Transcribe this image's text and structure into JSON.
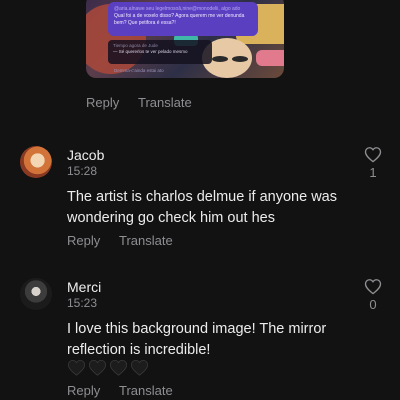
{
  "attachment": {
    "chat_top": "@aria.alnawe seu legelmosoâ,nine@monodelii, algo ado",
    "chat_line_1": "Qual foi a de voxelo disso? Agora querem me ver denunda",
    "chat_line_2": "bem? Que petifora é essa?!",
    "reply_header": "Tiempo agora de Jude",
    "reply_text": "— Sé quererlos te ver pelado mesmo",
    "footer": "Demma-c'ainda estai ato"
  },
  "post_actions": {
    "reply": "Reply",
    "translate": "Translate"
  },
  "comments": [
    {
      "author": "Jacob",
      "time": "15:28",
      "text": "The artist is charlos delmue if anyone was wondering go check him out hes",
      "likes": "1",
      "reply": "Reply",
      "translate": "Translate",
      "avatar": "avatar-jacob"
    },
    {
      "author": "Merci",
      "time": "15:23",
      "text": "I love this background image! The mirror reflection is incredible!",
      "emojis": "🖤🖤🖤🖤",
      "likes": "0",
      "reply": "Reply",
      "translate": "Translate",
      "avatar": "avatar-merci"
    }
  ],
  "colors": {
    "background": "#121212",
    "muted": "#8e8e93",
    "text": "#ececec"
  }
}
